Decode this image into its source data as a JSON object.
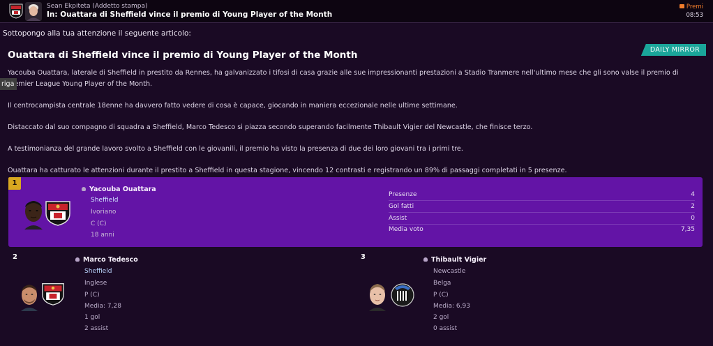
{
  "header": {
    "sender": "Sean Ekpiteta (Addetto stampa)",
    "subject": "In: Ouattara di Sheffield vince il premio di Young Player of the Month",
    "category": "Premi",
    "time": "08:53",
    "accent_color": "#f07c2c"
  },
  "intro": "Sottopongo alla tua attenzione il seguente articolo:",
  "article": {
    "source": "DAILY MIRROR",
    "headline": "Ouattara di Sheffield vince il premio di Young Player of the Month",
    "p1_line1": "Yacouba Ouattara, laterale di Sheffield in prestito da Rennes, ha galvanizzato i tifosi di casa grazie alle sue impressionanti prestazioni a Stadio Tranmere nell'ultimo mese che gli sono valse il premio di",
    "p1_line2": "Premier League Young Player of the Month.",
    "p2": "Il centrocampista centrale 18enne ha davvero fatto vedere di cosa è capace, giocando in maniera eccezionale nelle ultime settimane.",
    "p3": "Distaccato dal suo compagno di squadra a Sheffield, Marco Tedesco si piazza secondo superando facilmente Thibault Vigier del Newcastle, che finisce terzo.",
    "p4": "A testimonianza del grande lavoro svolto a Sheffield con le giovanili, il premio ha visto la presenza di due dei loro giovani tra i primi tre.",
    "p5": "Ouattara ha catturato le attenzioni durante il prestito a Sheffield in questa stagione, vincendo 12 contrasti e registrando un 89% di passaggi completati in 5 presenze."
  },
  "tooltip": "riga",
  "winner": {
    "rank": "1",
    "name": "Yacouba Ouattara",
    "club": "Sheffield",
    "nationality": "Ivoriano",
    "position": "C (C)",
    "age": "18 anni",
    "stats": [
      {
        "label": "Presenze",
        "value": "4"
      },
      {
        "label": "Gol fatti",
        "value": "2"
      },
      {
        "label": "Assist",
        "value": "0"
      },
      {
        "label": "Media voto",
        "value": "7,35"
      }
    ],
    "bg_color": "#6314a6"
  },
  "second": {
    "rank": "2",
    "name": "Marco Tedesco",
    "club": "Sheffield",
    "nationality": "Inglese",
    "position": "P (C)",
    "rating": "Media: 7,28",
    "goals": "1 gol",
    "assists": "2 assist"
  },
  "third": {
    "rank": "3",
    "name": "Thibault Vigier",
    "club": "Newcastle",
    "nationality": "Belga",
    "position": "P (C)",
    "rating": "Media: 6,93",
    "goals": "2 gol",
    "assists": "0 assist"
  }
}
